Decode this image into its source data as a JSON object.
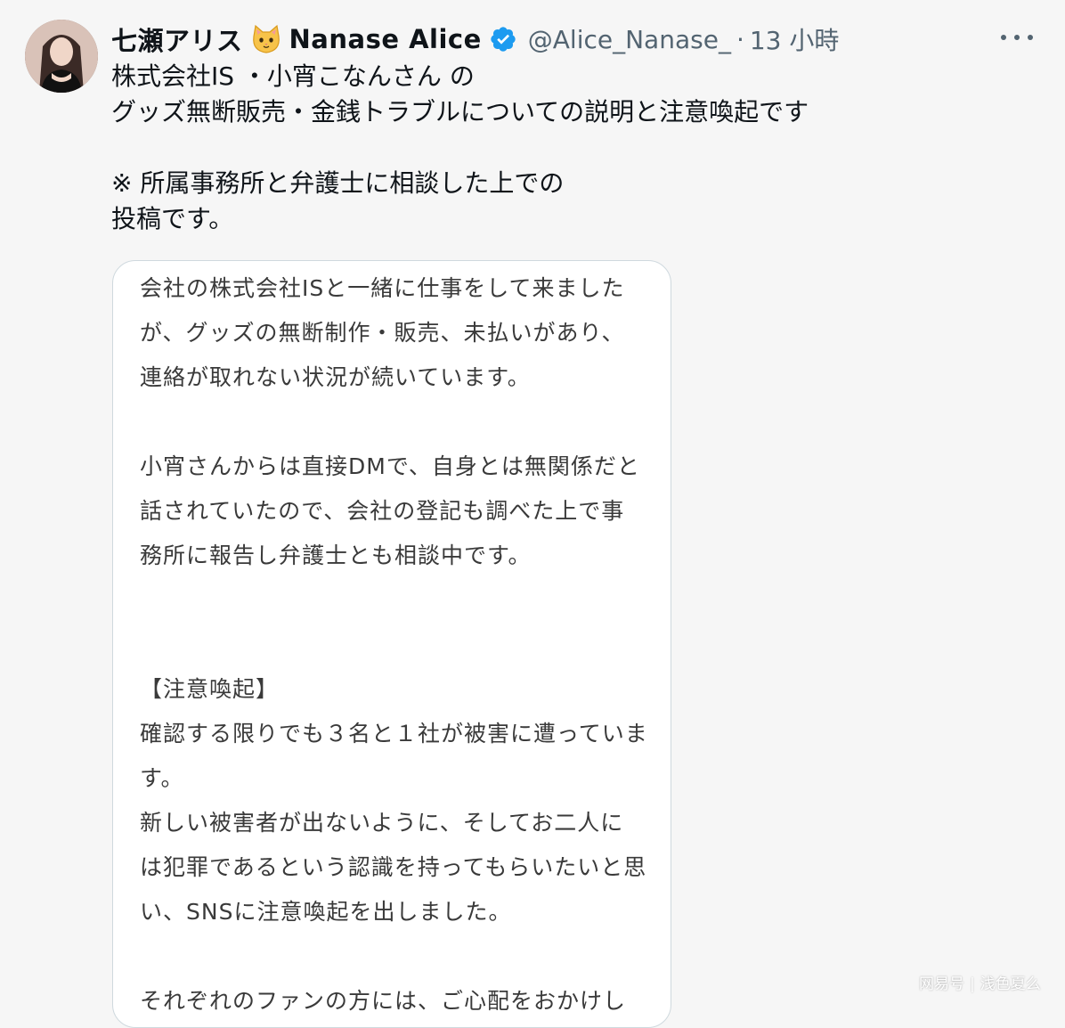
{
  "tweet": {
    "display_name": "七瀬アリス",
    "display_name_en": "Nanase Alice",
    "handle": "@Alice_Nanase_",
    "separator": "·",
    "time": "13 小時",
    "text_lines": [
      "株式会社IS ・小宵こなんさん の",
      "グッズ無断販売・金銭トラブルについての説明と注意喚起です",
      "",
      "※ 所属事務所と弁護士に相談した上での",
      "投稿です。"
    ]
  },
  "media": {
    "lines": [
      "会社の株式会社ISと一緒に仕事をして来ました",
      "が、グッズの無断制作・販売、未払いがあり、",
      "連絡が取れない状況が続いています。",
      "",
      "小宵さんからは直接DMで、自身とは無関係だと",
      "話されていたので、会社の登記も調べた上で事",
      "務所に報告し弁護士とも相談中です。",
      "",
      "",
      "【注意喚起】",
      "確認する限りでも３名と１社が被害に遭っていま",
      "す。",
      "新しい被害者が出ないように、そしてお二人に",
      "は犯罪であるという認識を持ってもらいたいと思",
      "い、SNSに注意喚起を出しました。",
      "",
      "それぞれのファンの方には、ご心配をおかけし"
    ]
  },
  "watermark": {
    "brand": "网易号",
    "author": "浅色夏么"
  },
  "icons": {
    "avatar": "avatar-photo",
    "cat": "cat-face-icon",
    "verified": "verified-badge-icon",
    "more": "more-options-icon"
  },
  "colors": {
    "verified": "#1d9bf0",
    "secondary_text": "#536471",
    "card_border": "#cfd9de"
  }
}
